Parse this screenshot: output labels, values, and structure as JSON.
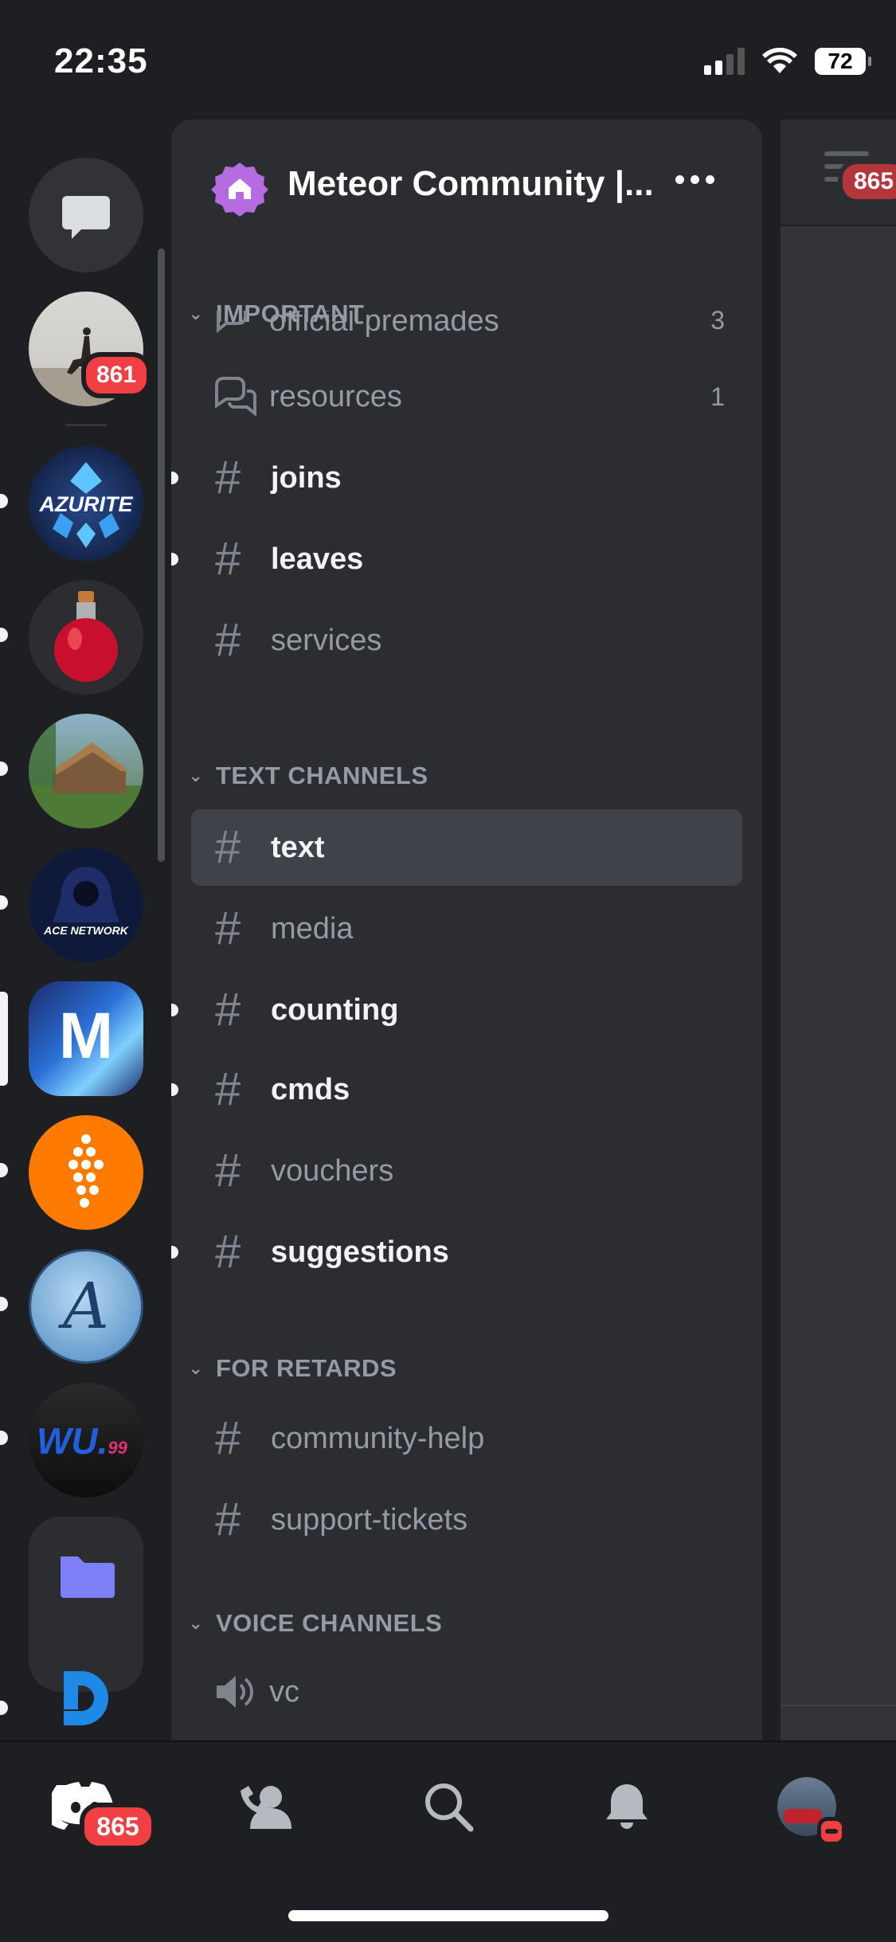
{
  "status_bar": {
    "time": "22:35",
    "battery": "72"
  },
  "server_rail": {
    "first_server_badge": "861",
    "servers": [
      {
        "name": "dm-server"
      },
      {
        "name": "desert-rider-server"
      },
      {
        "name": "azurite-server",
        "text": "AZURITE"
      },
      {
        "name": "potion-server"
      },
      {
        "name": "cabin-server"
      },
      {
        "name": "ace-network-server",
        "text": "ACE NETWORK"
      },
      {
        "name": "meteor-server",
        "text": "M"
      },
      {
        "name": "orange-server"
      },
      {
        "name": "a-server",
        "text": "A"
      },
      {
        "name": "wu-server",
        "text": "WU.",
        "text2": "99"
      },
      {
        "name": "folder"
      },
      {
        "name": "d-server"
      }
    ]
  },
  "header": {
    "server_name": "Meteor Community |..."
  },
  "categories": {
    "important": "IMPORTANT",
    "text_channels": "TEXT CHANNELS",
    "for_retards": "FOR RETARDS",
    "voice_channels": "VOICE CHANNELS"
  },
  "channels": {
    "official_premades": {
      "label": "official-premades",
      "count": "3"
    },
    "resources": {
      "label": "resources",
      "count": "1"
    },
    "joins": "joins",
    "leaves": "leaves",
    "services": "services",
    "text": "text",
    "media": "media",
    "counting": "counting",
    "cmds": "cmds",
    "vouchers": "vouchers",
    "suggestions": "suggestions",
    "community_help": "community-help",
    "support_tickets": "support-tickets",
    "vc": "vc"
  },
  "peek": {
    "badge": "865"
  },
  "bottom_nav": {
    "home_badge": "865"
  },
  "colors": {
    "accent_red": "#f23f43",
    "selected_channel": "#404249",
    "panel": "#2b2d31"
  }
}
